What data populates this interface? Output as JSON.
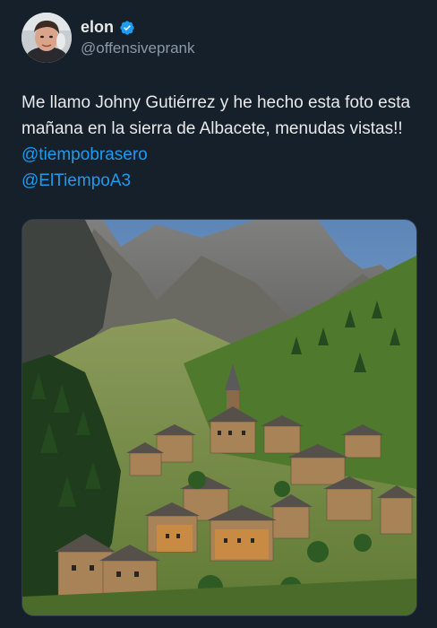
{
  "author": {
    "display_name": "elon",
    "handle": "@offensiveprank",
    "verified": true,
    "avatar_icon": "avatar-photo"
  },
  "tweet": {
    "text_parts": [
      "Me llamo Johny Gutiérrez y he hecho esta foto esta mañana en la sierra de Albacete, menudas vistas!! "
    ],
    "mentions": [
      "@tiempobrasero",
      "@ElTiempoA3"
    ]
  },
  "media": {
    "icon": "photo-mountain-village"
  },
  "colors": {
    "background": "#15202b",
    "text": "#e7e9ea",
    "secondary": "#8b98a5",
    "link": "#1d9bf0",
    "verified_badge": "#1d9bf0"
  }
}
